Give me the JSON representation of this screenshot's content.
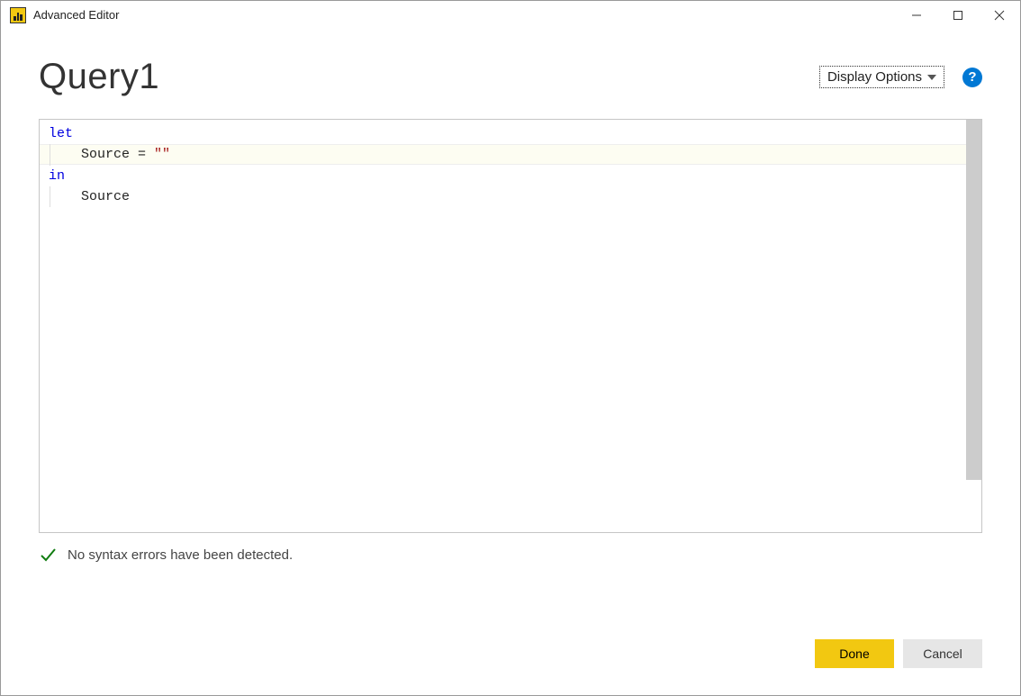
{
  "titlebar": {
    "title": "Advanced Editor"
  },
  "header": {
    "query_name": "Query1",
    "display_options_label": "Display Options",
    "help_label": "?"
  },
  "editor": {
    "code": {
      "line1_kw": "let",
      "line2_indent": "Source = ",
      "line2_str": "\"\"",
      "line3_kw": "in",
      "line4_indent": "Source"
    }
  },
  "status": {
    "message": "No syntax errors have been detected."
  },
  "footer": {
    "done_label": "Done",
    "cancel_label": "Cancel"
  }
}
